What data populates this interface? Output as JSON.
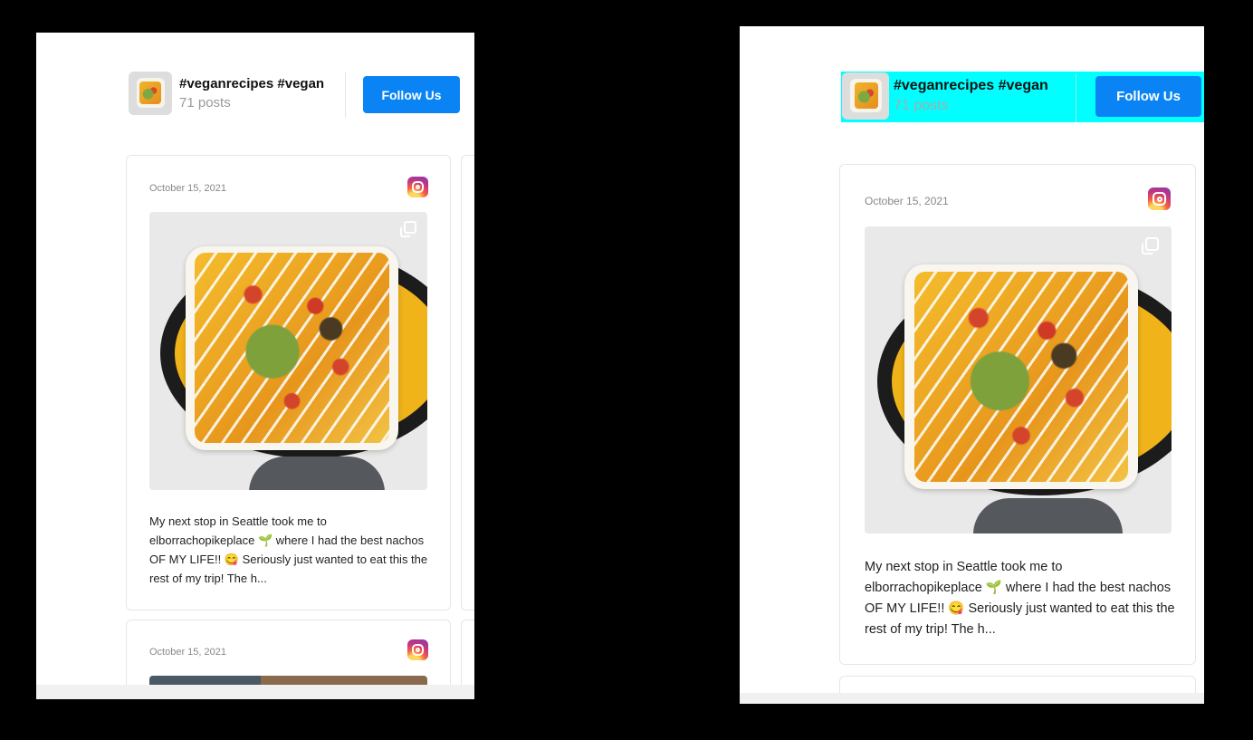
{
  "feed": {
    "title": "#veganrecipes #vegan",
    "posts_count": "71 posts",
    "follow_label": "Follow Us"
  },
  "posts": [
    {
      "date": "October 15, 2021",
      "source_icon": "instagram-icon",
      "caption": "My next stop in Seattle took me to elborrachopikeplace 🌱 where I had the best nachos OF MY LIFE!! 😋 Seriously just wanted to eat this the rest of my trip! The h..."
    },
    {
      "date": "October 15, 2021",
      "source_icon": "instagram-icon"
    }
  ],
  "colors": {
    "follow_button": "#0a84f5",
    "highlight": "#00ffff",
    "background": "#000000"
  }
}
